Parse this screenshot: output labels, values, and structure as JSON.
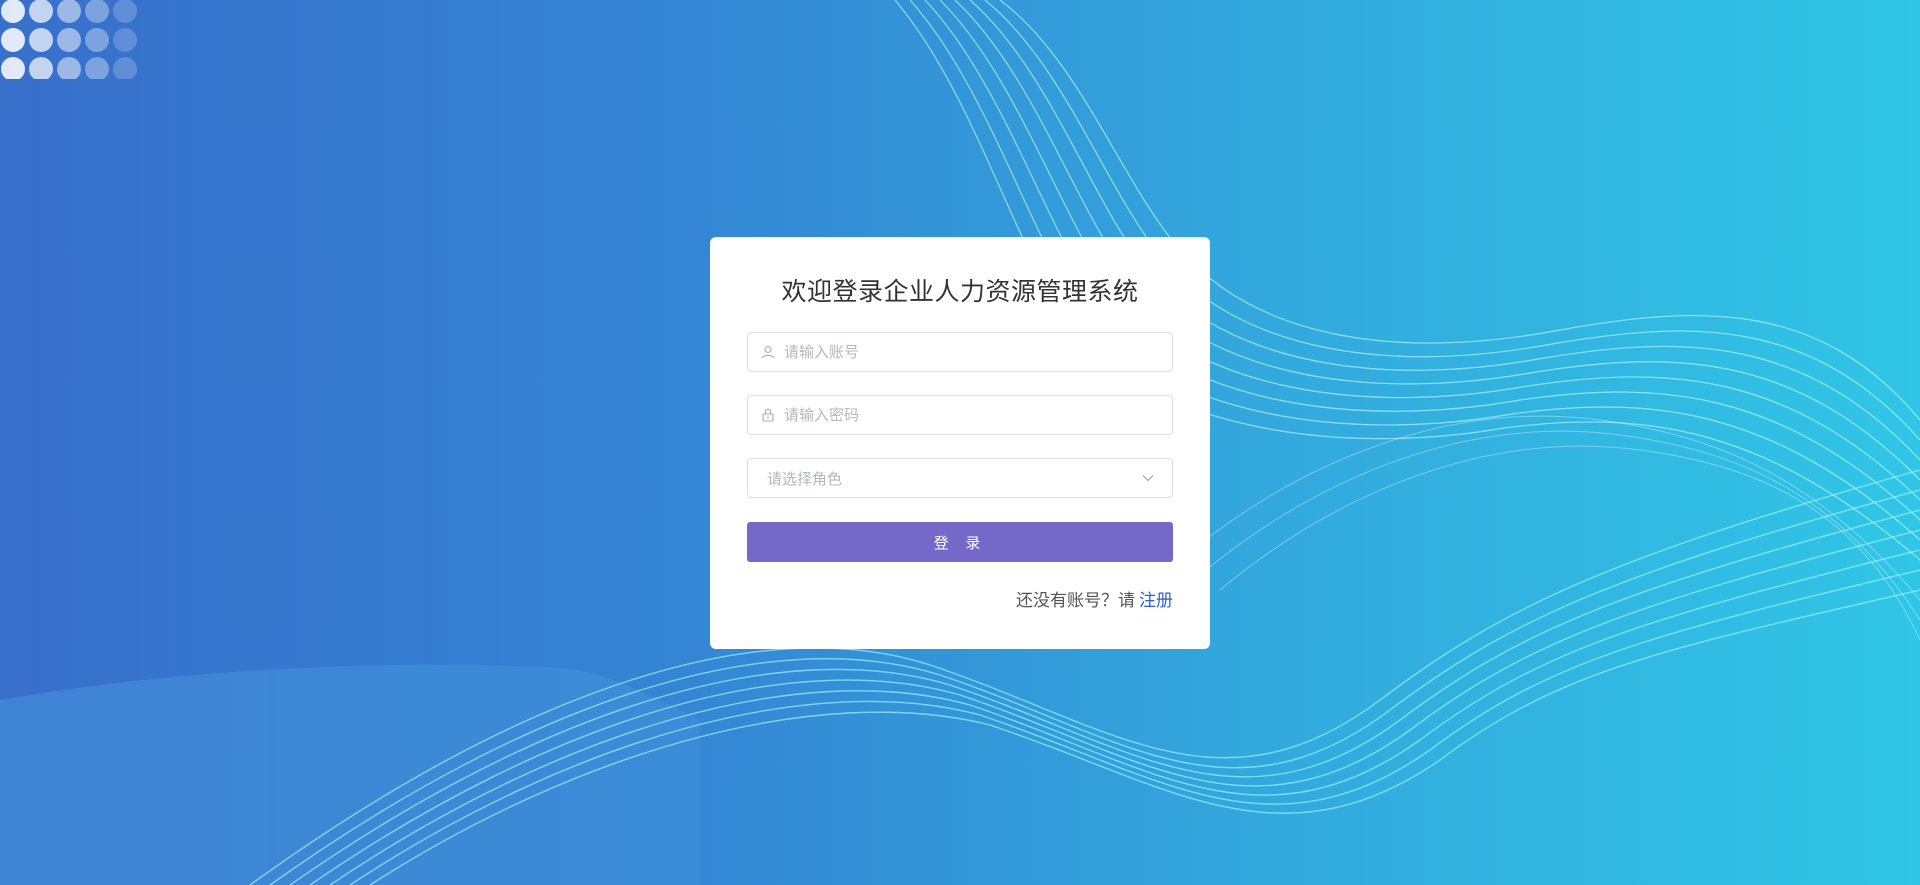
{
  "login": {
    "title": "欢迎登录企业人力资源管理系统",
    "username_placeholder": "请输入账号",
    "password_placeholder": "请输入密码",
    "role_placeholder": "请选择角色",
    "login_button": "登 录",
    "register_prompt": "还没有账号？请",
    "register_link": "注册"
  },
  "icons": {
    "username": "user-icon",
    "password": "lock-icon",
    "role": "chevron-down-icon"
  },
  "colors": {
    "primary_button": "#7469c8",
    "link": "#2b5fcf",
    "background_start": "#2b66c8",
    "background_end": "#30c6e6"
  }
}
